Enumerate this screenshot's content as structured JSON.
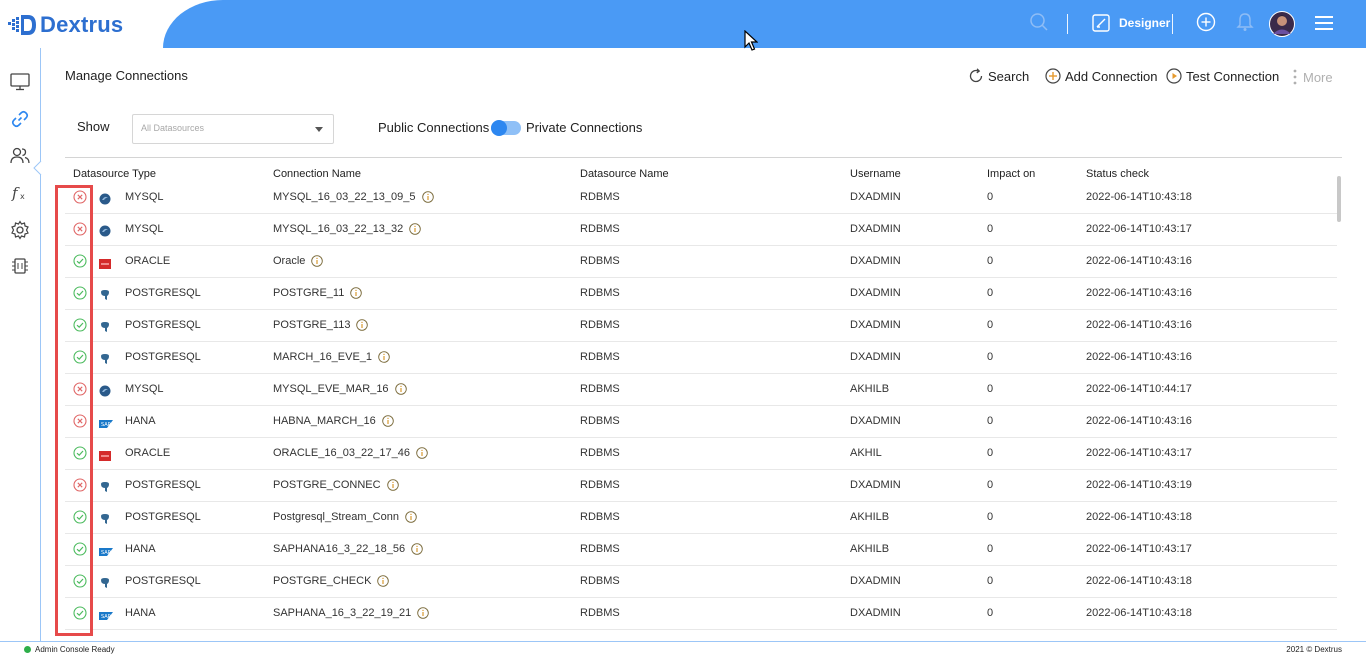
{
  "app": {
    "name": "Dextrus",
    "brand_color": "#4a9af5",
    "logo_color": "#2d6fd0"
  },
  "header": {
    "designer_label": "Designer"
  },
  "page": {
    "title": "Manage Connections",
    "toolbar": {
      "search": "Search",
      "add_connection": "Add Connection",
      "test_connection": "Test Connection",
      "more": "More"
    },
    "filter": {
      "show_label": "Show",
      "datasource_select": "All Datasources",
      "public_label": "Public Connections",
      "private_label": "Private Connections",
      "toggle_state": "private"
    }
  },
  "table": {
    "columns": [
      "Datasource Type",
      "Connection Name",
      "Datasource Name",
      "Username",
      "Impact on",
      "Status check"
    ],
    "rows": [
      {
        "status": "fail",
        "type": "MYSQL",
        "name": "MYSQL_16_03_22_13_09_5",
        "ds": "RDBMS",
        "user": "DXADMIN",
        "impact": "0",
        "check": "2022-06-14T10:43:18"
      },
      {
        "status": "fail",
        "type": "MYSQL",
        "name": "MYSQL_16_03_22_13_32",
        "ds": "RDBMS",
        "user": "DXADMIN",
        "impact": "0",
        "check": "2022-06-14T10:43:17"
      },
      {
        "status": "ok",
        "type": "ORACLE",
        "name": "Oracle",
        "ds": "RDBMS",
        "user": "DXADMIN",
        "impact": "0",
        "check": "2022-06-14T10:43:16"
      },
      {
        "status": "ok",
        "type": "POSTGRESQL",
        "name": "POSTGRE_11",
        "ds": "RDBMS",
        "user": "DXADMIN",
        "impact": "0",
        "check": "2022-06-14T10:43:16"
      },
      {
        "status": "ok",
        "type": "POSTGRESQL",
        "name": "POSTGRE_113",
        "ds": "RDBMS",
        "user": "DXADMIN",
        "impact": "0",
        "check": "2022-06-14T10:43:16"
      },
      {
        "status": "ok",
        "type": "POSTGRESQL",
        "name": "MARCH_16_EVE_1",
        "ds": "RDBMS",
        "user": "DXADMIN",
        "impact": "0",
        "check": "2022-06-14T10:43:16"
      },
      {
        "status": "fail",
        "type": "MYSQL",
        "name": "MYSQL_EVE_MAR_16",
        "ds": "RDBMS",
        "user": "AKHILB",
        "impact": "0",
        "check": "2022-06-14T10:44:17"
      },
      {
        "status": "fail",
        "type": "HANA",
        "name": "HABNA_MARCH_16",
        "ds": "RDBMS",
        "user": "DXADMIN",
        "impact": "0",
        "check": "2022-06-14T10:43:16"
      },
      {
        "status": "ok",
        "type": "ORACLE",
        "name": "ORACLE_16_03_22_17_46",
        "ds": "RDBMS",
        "user": "AKHIL",
        "impact": "0",
        "check": "2022-06-14T10:43:17"
      },
      {
        "status": "fail",
        "type": "POSTGRESQL",
        "name": "POSTGRE_CONNEC",
        "ds": "RDBMS",
        "user": "DXADMIN",
        "impact": "0",
        "check": "2022-06-14T10:43:19"
      },
      {
        "status": "ok",
        "type": "POSTGRESQL",
        "name": "Postgresql_Stream_Conn",
        "ds": "RDBMS",
        "user": "AKHILB",
        "impact": "0",
        "check": "2022-06-14T10:43:18"
      },
      {
        "status": "ok",
        "type": "HANA",
        "name": "SAPHANA16_3_22_18_56",
        "ds": "RDBMS",
        "user": "AKHILB",
        "impact": "0",
        "check": "2022-06-14T10:43:17"
      },
      {
        "status": "ok",
        "type": "POSTGRESQL",
        "name": "POSTGRE_CHECK",
        "ds": "RDBMS",
        "user": "DXADMIN",
        "impact": "0",
        "check": "2022-06-14T10:43:18"
      },
      {
        "status": "ok",
        "type": "HANA",
        "name": "SAPHANA_16_3_22_19_21",
        "ds": "RDBMS",
        "user": "DXADMIN",
        "impact": "0",
        "check": "2022-06-14T10:43:18"
      }
    ],
    "status_colors": {
      "ok": "#4cbb5e",
      "fail": "#e06666"
    },
    "type_icons": {
      "MYSQL": "mysql-dolphin-icon",
      "ORACLE": "oracle-icon",
      "POSTGRESQL": "postgresql-elephant-icon",
      "HANA": "sap-hana-icon"
    }
  },
  "footer": {
    "status": "Admin Console Ready",
    "copyright": "2021 © Dextrus"
  }
}
